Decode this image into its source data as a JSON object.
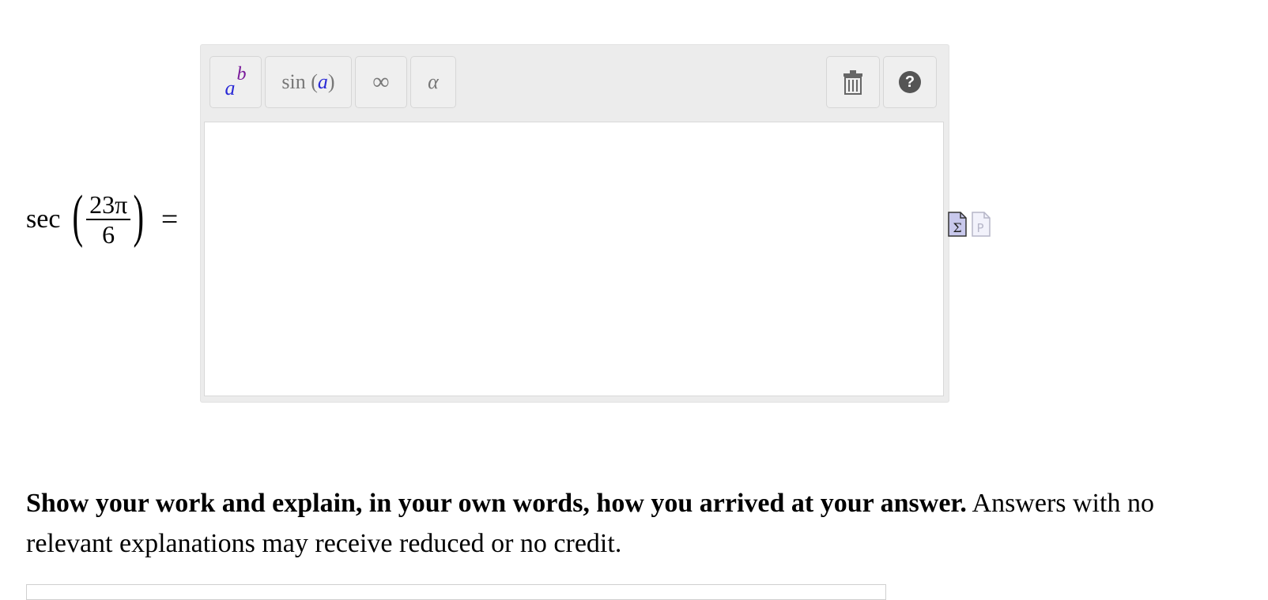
{
  "equation": {
    "func": "sec",
    "numerator": "23π",
    "denominator": "6",
    "equals": "="
  },
  "toolbar": {
    "power_button": {
      "base": "a",
      "exponent": "b"
    },
    "trig_button": {
      "func": "sin",
      "open": "(",
      "arg": "a",
      "close": ")"
    },
    "infinity_button": "∞",
    "greek_button": "α",
    "trash_button": "trash-icon",
    "help_button": "?"
  },
  "answer_area": {
    "value": ""
  },
  "side_icons": [
    "equation-editor-icon",
    "plain-text-icon"
  ],
  "instructions": {
    "bold": "Show your work and explain, in your own words, how you arrived at your answer.",
    "rest": "Answers with no relevant explanations may receive reduced or no credit."
  }
}
